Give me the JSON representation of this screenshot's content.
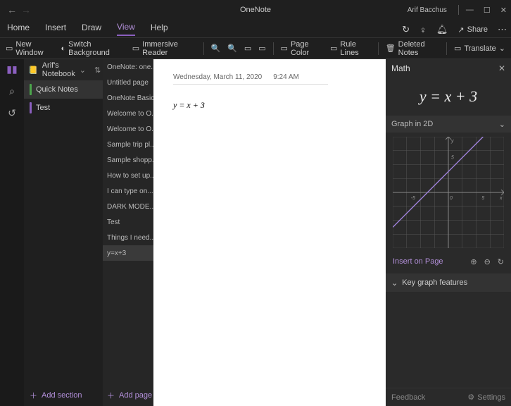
{
  "app": {
    "title": "OneNote",
    "user": "Arif Bacchus"
  },
  "menu": {
    "tabs": [
      "Home",
      "Insert",
      "Draw",
      "View",
      "Help"
    ],
    "active": 3
  },
  "ribbon": {
    "new_window": "New Window",
    "switch_bg": "Switch Background",
    "immersive": "Immersive Reader",
    "page_color": "Page Color",
    "rule_lines": "Rule Lines",
    "deleted_notes": "Deleted Notes",
    "translate": "Translate"
  },
  "header_actions": {
    "share": "Share"
  },
  "notebook": {
    "name": "Arif's Notebook"
  },
  "sections": [
    {
      "label": "Quick Notes",
      "color": "green",
      "active": true
    },
    {
      "label": "Test",
      "color": "purple",
      "active": false
    }
  ],
  "add_section": "Add section",
  "pages": [
    "OneNote: one...",
    "Untitled page",
    "OneNote Basics",
    "Welcome to O...",
    "Welcome to O...",
    "Sample trip pl...",
    "Sample shopp...",
    "How to set up...",
    "I can type on...",
    "DARK MODE...",
    "Test",
    "Things I need...",
    "y=x+3"
  ],
  "pages_active": 12,
  "add_page": "Add page",
  "canvas": {
    "date": "Wednesday, March 11, 2020",
    "time": "9:24 AM",
    "equation": "y = x + 3"
  },
  "math": {
    "title": "Math",
    "equation": "y = x + 3",
    "graph_label": "Graph in 2D",
    "insert": "Insert on Page",
    "key_features": "Key graph features",
    "feedback": "Feedback",
    "settings": "Settings"
  },
  "chart_data": {
    "type": "line",
    "title": "Graph in 2D",
    "equation": "y = x + 3",
    "x": [
      -8,
      5
    ],
    "y": [
      -5,
      8
    ],
    "xlabel": "x",
    "ylabel": "y",
    "xlim": [
      -8,
      8
    ],
    "ylim": [
      -8,
      8
    ],
    "x_ticks": [
      -5,
      0,
      5
    ],
    "y_ticks": [
      -5,
      0,
      5
    ],
    "grid": true
  }
}
